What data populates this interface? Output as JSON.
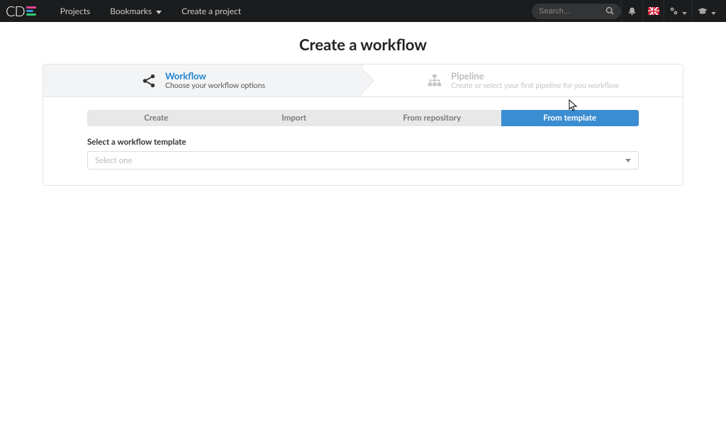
{
  "nav": {
    "projects": "Projects",
    "bookmarks": "Bookmarks",
    "create_project": "Create a project",
    "search_placeholder": "Search..."
  },
  "page": {
    "title": "Create a workflow"
  },
  "steps": {
    "workflow": {
      "title": "Workflow",
      "desc": "Choose your workflow options"
    },
    "pipeline": {
      "title": "Pipeline",
      "desc": "Create or select your first pipeline for you workflow"
    }
  },
  "tabs": {
    "create": "Create",
    "import": "Import",
    "from_repository": "From repository",
    "from_template": "From template"
  },
  "form": {
    "select_label": "Select a workflow template",
    "select_placeholder": "Select one"
  }
}
